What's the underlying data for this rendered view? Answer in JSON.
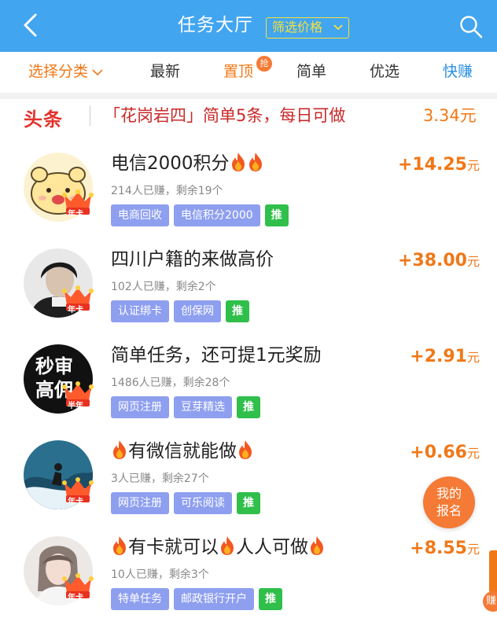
{
  "header": {
    "title": "任务大厅",
    "filter_label": "筛选价格"
  },
  "tabs": [
    {
      "label": "选择分类"
    },
    {
      "label": "最新"
    },
    {
      "label": "置顶",
      "badge": "抢"
    },
    {
      "label": "简单"
    },
    {
      "label": "优选"
    },
    {
      "label": "快赚"
    }
  ],
  "headline": {
    "logo": "头条",
    "text": "「花岗岩四」简单5条，每日可做",
    "amount": "3.34元"
  },
  "tasks": [
    {
      "title": "电信2000积分",
      "reward": "+14.25",
      "unit": "元",
      "stats": "214人已赚，剩余19个",
      "tags": [
        "电商回收",
        "电信积分2000"
      ],
      "push": "推",
      "crown_text": "年卡"
    },
    {
      "title": "四川户籍的来做高价",
      "reward": "+38.00",
      "unit": "元",
      "stats": "102人已赚，剩余2个",
      "tags": [
        "认证绑卡",
        "创保网"
      ],
      "push": "推",
      "crown_text": "年卡"
    },
    {
      "title": "简单任务，还可提1元奖励",
      "reward": "+2.91",
      "unit": "元",
      "stats": "1486人已赚，剩余28个",
      "tags": [
        "网页注册",
        "豆芽精选"
      ],
      "push": "推",
      "crown_text": "半年",
      "avatar_text_1": "秒审",
      "avatar_text_2": "高佣"
    },
    {
      "title": "有微信就能做",
      "reward": "+0.66",
      "unit": "元",
      "stats": "3人已赚，剩余27个",
      "tags": [
        "网页注册",
        "可乐阅读"
      ],
      "push": "推",
      "crown_text": "年卡"
    },
    {
      "title_a": "有卡就可以",
      "title_b": "人人可做",
      "reward": "+8.55",
      "unit": "元",
      "stats": "10人已赚，剩余3个",
      "tags": [
        "特单任务",
        "邮政银行开户"
      ],
      "push": "推",
      "crown_text": "年卡"
    }
  ],
  "float_button": {
    "line1": "我的",
    "line2": "报名"
  },
  "edge_label": "赚",
  "colors": {
    "header_bg": "#42a5f0",
    "accent_orange": "#f07818",
    "filter_yellow": "#f6e23a",
    "tag_purple": "#8e9ff0",
    "push_green": "#2fbf4a",
    "headline_red": "#c92a2a"
  },
  "icons": [
    "back-arrow-icon",
    "chevron-down-icon",
    "search-icon",
    "fire-icon",
    "crown-icon"
  ]
}
